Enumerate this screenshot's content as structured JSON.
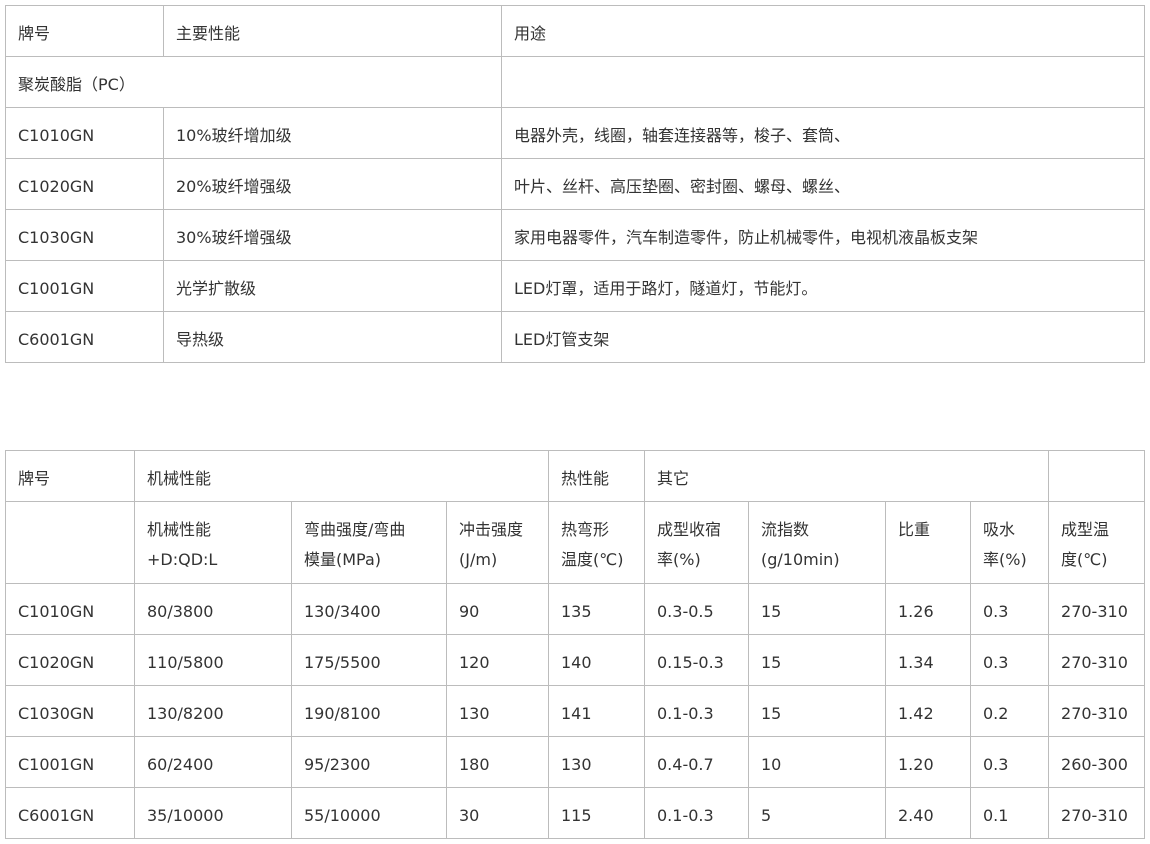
{
  "table1": {
    "headers": [
      "牌号",
      "主要性能",
      "用途"
    ],
    "group_label": "聚炭酸脂（PC）",
    "rows": [
      {
        "grade": "C1010GN",
        "performance": "10%玻纤增加级",
        "usage": "电器外壳，线圈，轴套连接器等，梭子、套筒、"
      },
      {
        "grade": "C1020GN",
        "performance": "20%玻纤增强级",
        "usage": "叶片、丝杆、高压垫圈、密封圈、螺母、螺丝、"
      },
      {
        "grade": "C1030GN",
        "performance": "30%玻纤增强级",
        "usage": "家用电器零件，汽车制造零件，防止机械零件，电视机液晶板支架"
      },
      {
        "grade": "C1001GN",
        "performance": "光学扩散级",
        "usage": "LED灯罩，适用于路灯，隧道灯，节能灯。"
      },
      {
        "grade": "C6001GN",
        "performance": "导热级",
        "usage": "LED灯管支架"
      }
    ]
  },
  "table2": {
    "group_headers": {
      "grade": "牌号",
      "mechanical": "机械性能",
      "thermal": "热性能",
      "other": "其它"
    },
    "sub_headers": [
      [
        "机械性能",
        "+D:QD:L"
      ],
      [
        "弯曲强度/弯曲",
        "模量(MPa)"
      ],
      [
        "冲击强度",
        "(J/m)"
      ],
      [
        "热弯形",
        "温度(℃)"
      ],
      [
        "成型收宿",
        "率(%)"
      ],
      [
        "流指数",
        "(g/10min)"
      ],
      [
        "比重",
        ""
      ],
      [
        "吸水",
        "率(%)"
      ],
      [
        "成型温",
        "度(℃)"
      ]
    ],
    "rows": [
      [
        "C1010GN",
        "80/3800",
        "130/3400",
        "90",
        "135",
        "0.3-0.5",
        "15",
        "1.26",
        "0.3",
        "270-310"
      ],
      [
        "C1020GN",
        "110/5800",
        "175/5500",
        "120",
        "140",
        "0.15-0.3",
        "15",
        "1.34",
        "0.3",
        "270-310"
      ],
      [
        "C1030GN",
        "130/8200",
        "190/8100",
        "130",
        "141",
        "0.1-0.3",
        "15",
        "1.42",
        "0.2",
        "270-310"
      ],
      [
        "C1001GN",
        "60/2400",
        "95/2300",
        "180",
        "130",
        "0.4-0.7",
        "10",
        "1.20",
        "0.3",
        "260-300"
      ],
      [
        "C6001GN",
        "35/10000",
        "55/10000",
        "30",
        "115",
        "0.1-0.3",
        "5",
        "2.40",
        "0.1",
        "270-310"
      ]
    ]
  }
}
